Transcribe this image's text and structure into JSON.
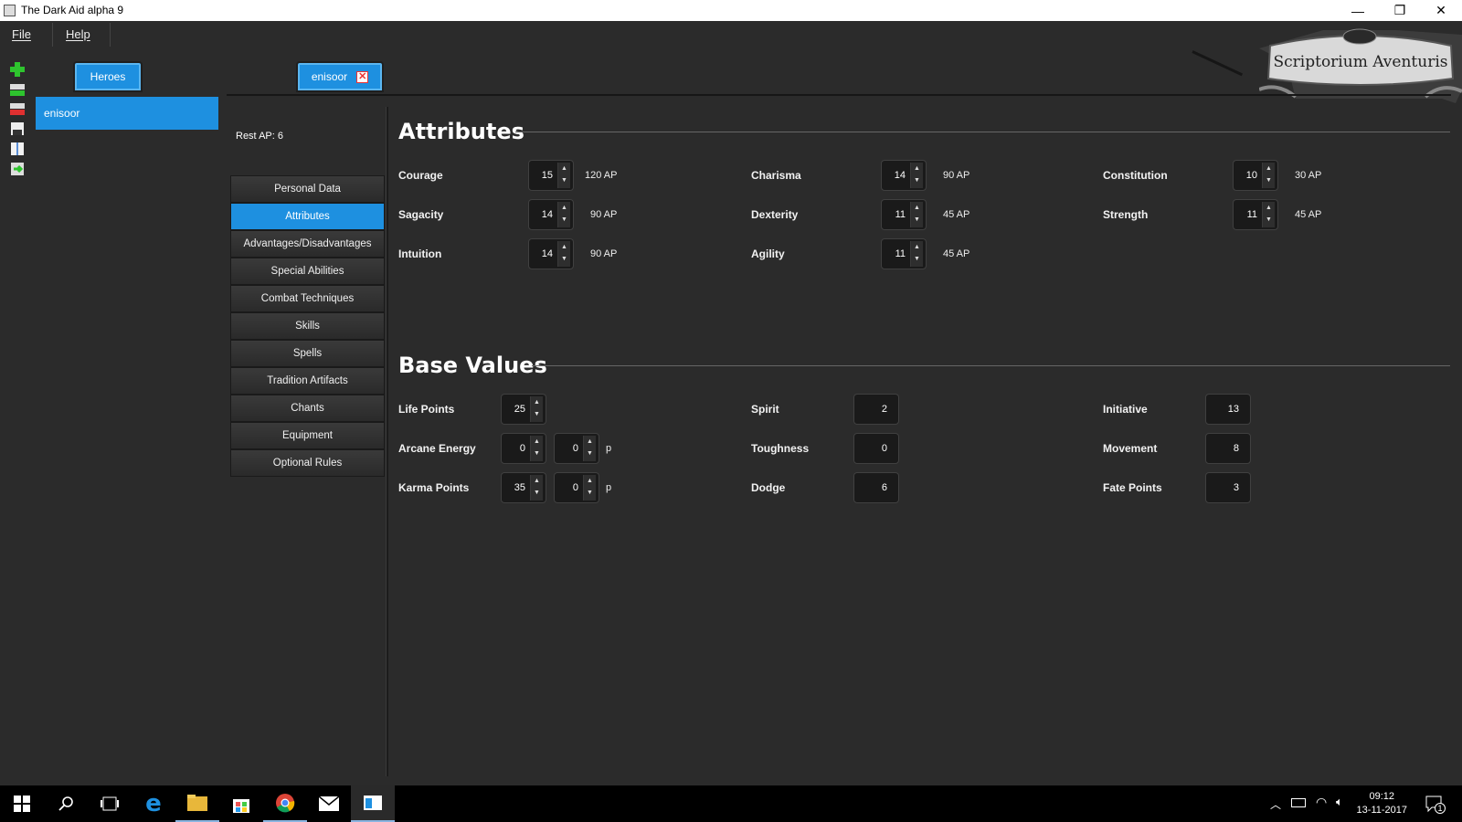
{
  "window": {
    "title": "The Dark Aid alpha 9"
  },
  "menu": {
    "file": "File",
    "help": "Help"
  },
  "logo": {
    "text": "Scriptorium Aventuris"
  },
  "tabs": {
    "heroes": "Heroes",
    "hero": "enisoor"
  },
  "hero_list": {
    "selected": "enisoor"
  },
  "rest_ap": "Rest AP: 6",
  "nav": {
    "items": [
      "Personal Data",
      "Attributes",
      "Advantages/Disadvantages",
      "Special Abilities",
      "Combat Techniques",
      "Skills",
      "Spells",
      "Tradition Artifacts",
      "Chants",
      "Equipment",
      "Optional Rules"
    ],
    "active": "Attributes"
  },
  "attributes": {
    "title": "Attributes",
    "courage": {
      "label": "Courage",
      "value": "15",
      "ap": "120 AP"
    },
    "sagacity": {
      "label": "Sagacity",
      "value": "14",
      "ap": "90 AP"
    },
    "intuition": {
      "label": "Intuition",
      "value": "14",
      "ap": "90 AP"
    },
    "charisma": {
      "label": "Charisma",
      "value": "14",
      "ap": "90 AP"
    },
    "dexterity": {
      "label": "Dexterity",
      "value": "11",
      "ap": "45 AP"
    },
    "agility": {
      "label": "Agility",
      "value": "11",
      "ap": "45 AP"
    },
    "constitution": {
      "label": "Constitution",
      "value": "10",
      "ap": "30 AP"
    },
    "strength": {
      "label": "Strength",
      "value": "11",
      "ap": "45 AP"
    }
  },
  "base_values": {
    "title": "Base Values",
    "life_points": {
      "label": "Life Points",
      "value": "25"
    },
    "arcane_energy": {
      "label": "Arcane Energy",
      "value": "0",
      "extra": "0",
      "unit": "p"
    },
    "karma_points": {
      "label": "Karma Points",
      "value": "35",
      "extra": "0",
      "unit": "p"
    },
    "spirit": {
      "label": "Spirit",
      "value": "2"
    },
    "toughness": {
      "label": "Toughness",
      "value": "0"
    },
    "dodge": {
      "label": "Dodge",
      "value": "6"
    },
    "initiative": {
      "label": "Initiative",
      "value": "13"
    },
    "movement": {
      "label": "Movement",
      "value": "8"
    },
    "fate_points": {
      "label": "Fate Points",
      "value": "3"
    }
  },
  "taskbar": {
    "time": "09:12",
    "date": "13-11-2017",
    "notifications": "1"
  },
  "colors": {
    "accent": "#1e90e0",
    "background": "#2b2b2b"
  }
}
